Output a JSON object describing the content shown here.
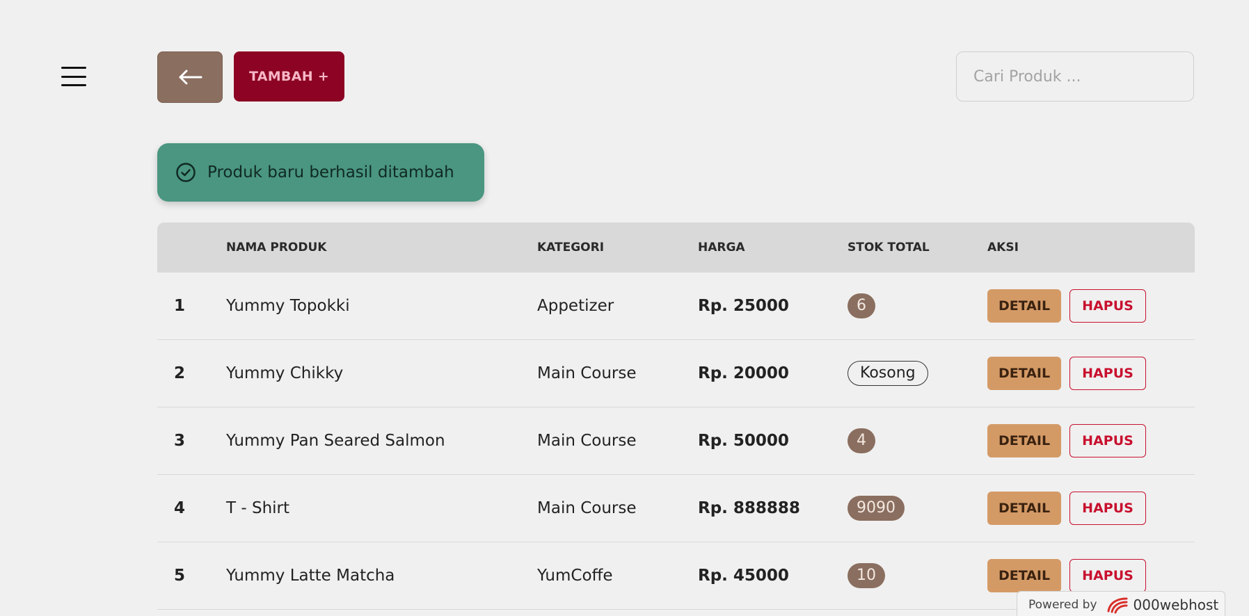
{
  "header": {
    "menu_icon": "hamburger-icon",
    "back_icon": "arrow-left-icon",
    "add_label": "TAMBAH +",
    "search_placeholder": "Cari Produk ..."
  },
  "alert": {
    "icon": "check-circle-icon",
    "message": "Produk baru berhasil ditambah"
  },
  "table": {
    "columns": [
      "",
      "NAMA PRODUK",
      "KATEGORI",
      "HARGA",
      "STOK TOTAL",
      "AKSI"
    ],
    "detail_label": "DETAIL",
    "delete_label": "HAPUS",
    "rows": [
      {
        "no": "1",
        "name": "Yummy Topokki",
        "category": "Appetizer",
        "price": "Rp. 25000",
        "stock": "6",
        "empty": false
      },
      {
        "no": "2",
        "name": "Yummy Chikky",
        "category": "Main Course",
        "price": "Rp. 20000",
        "stock": "Kosong",
        "empty": true
      },
      {
        "no": "3",
        "name": "Yummy Pan Seared Salmon",
        "category": "Main Course",
        "price": "Rp. 50000",
        "stock": "4",
        "empty": false
      },
      {
        "no": "4",
        "name": "T - Shirt",
        "category": "Main Course",
        "price": "Rp. 888888",
        "stock": "9090",
        "empty": false
      },
      {
        "no": "5",
        "name": "Yummy Latte Matcha",
        "category": "YumCoffe",
        "price": "Rp. 45000",
        "stock": "10",
        "empty": false
      }
    ]
  },
  "footer": {
    "powered_label": "Powered by",
    "brand": "000webhost"
  },
  "colors": {
    "background": "#f0f0f0",
    "back_button": "#8a6e5f",
    "add_button": "#8c0324",
    "alert": "#4a9680",
    "detail_button": "#d49a66",
    "delete_border": "#c8102e"
  }
}
